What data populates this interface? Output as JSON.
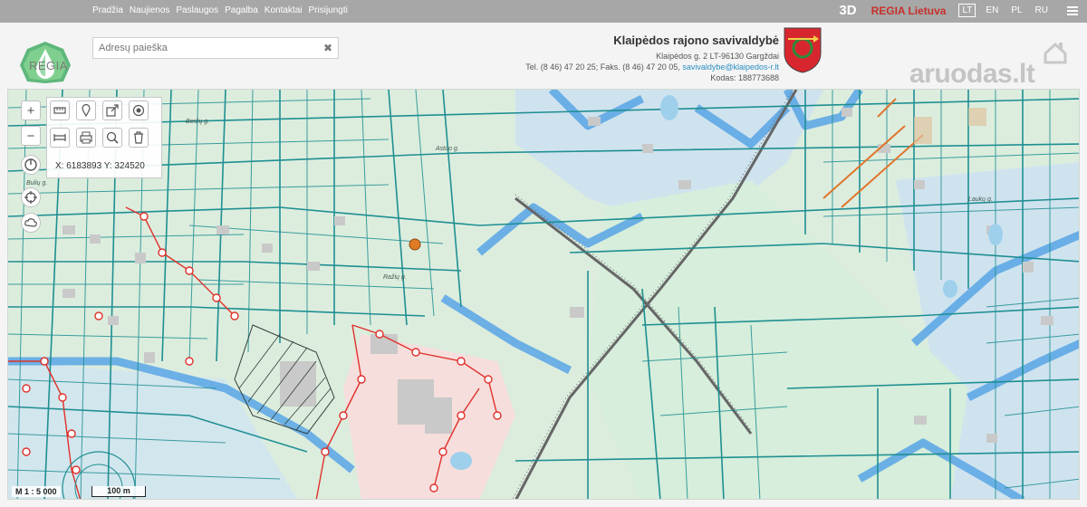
{
  "nav": {
    "links": [
      "Pradžia",
      "Naujienos",
      "Paslaugos",
      "Pagalba",
      "Kontaktai",
      "Prisijungti"
    ]
  },
  "top_right": {
    "btn_3d": "3D",
    "regia_lt": "REGIA Lietuva",
    "languages": [
      "LT",
      "EN",
      "PL",
      "RU"
    ],
    "active_language": "LT"
  },
  "logo": {
    "text": "REGIA"
  },
  "search": {
    "placeholder": "Adresų paieška",
    "value": ""
  },
  "municipality": {
    "name": "Klaipėdos rajono savivaldybė",
    "address": "Klaipėdos g. 2 LT-96130 Gargždai",
    "phone": "Tel. (8 46) 47 20 25; Faks. (8 46) 47 20 05,",
    "email": "savivaldybe@klaipedos-r.lt",
    "code": "Kodas: 188773688"
  },
  "watermark": {
    "text": "aruodas.lt"
  },
  "map": {
    "coordinates": "X: 6183893 Y: 324520",
    "scale": "M 1 : 5 000",
    "scalebar": "100 m",
    "streets": [
      "Bulių g.",
      "Beržų g.",
      "Astuo g.",
      "Ražių g.",
      "Laukų g."
    ],
    "colors": {
      "land": "#dcedde",
      "parcel": "#1f8f92",
      "water_buffer": "#5fa9e6",
      "marker": "#e07b25",
      "utility_red": "#e0312b"
    }
  }
}
